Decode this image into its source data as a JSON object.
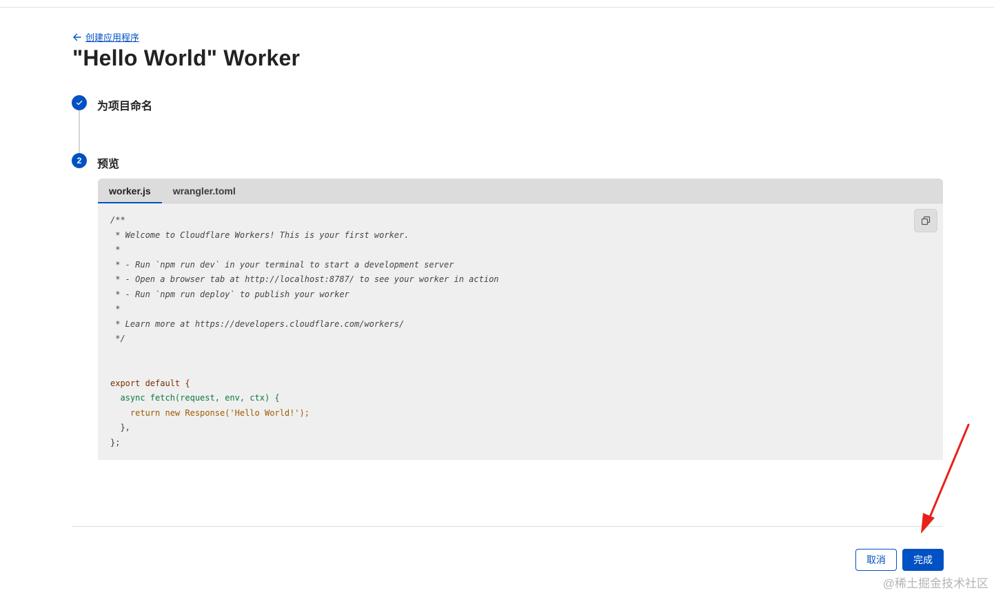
{
  "back_link": {
    "label": "创建应用程序",
    "icon": "arrow-left-icon"
  },
  "page_title": "\"Hello World\" Worker",
  "steps": [
    {
      "number": "1",
      "label": "为项目命名",
      "status": "completed",
      "icon": "check-icon"
    },
    {
      "number": "2",
      "label": "预览",
      "status": "active"
    }
  ],
  "code_panel": {
    "tabs": [
      {
        "label": "worker.js",
        "active": true
      },
      {
        "label": "wrangler.toml",
        "active": false
      }
    ],
    "copy_icon": "copy-icon",
    "code_lines": [
      "/**",
      " * Welcome to Cloudflare Workers! This is your first worker.",
      " *",
      " * - Run `npm run dev` in your terminal to start a development server",
      " * - Open a browser tab at http://localhost:8787/ to see your worker in action",
      " * - Run `npm run deploy` to publish your worker",
      " *",
      " * Learn more at https://developers.cloudflare.com/workers/",
      " */",
      "",
      "",
      "export default {",
      "  async fetch(request, env, ctx) {",
      "    return new Response('Hello World!');",
      "  },",
      "};"
    ]
  },
  "footer": {
    "cancel_label": "取消",
    "done_label": "完成"
  },
  "watermark": "@稀土掘金技术社区",
  "colors": {
    "accent": "#0051c3",
    "code_bg": "#efefef",
    "tab_bar_bg": "#dcdcdc",
    "annotation_arrow": "#e8211d"
  }
}
